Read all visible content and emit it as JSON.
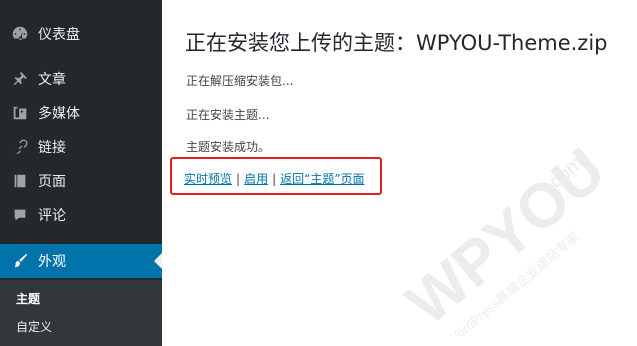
{
  "sidebar": {
    "items": [
      {
        "label": "仪表盘",
        "icon": "dashboard-icon"
      },
      {
        "label": "文章",
        "icon": "pushpin-icon"
      },
      {
        "label": "多媒体",
        "icon": "media-icon"
      },
      {
        "label": "链接",
        "icon": "link-icon"
      },
      {
        "label": "页面",
        "icon": "page-icon"
      },
      {
        "label": "评论",
        "icon": "comment-icon"
      },
      {
        "label": "外观",
        "icon": "paintbrush-icon",
        "active": true
      }
    ],
    "submenu": [
      {
        "label": "主题",
        "current": true
      },
      {
        "label": "自定义"
      }
    ]
  },
  "main": {
    "title": "正在安装您上传的主题：WPYOU-Theme.zip",
    "messages": [
      "正在解压缩安装包...",
      "正在安装主题...",
      "主题安装成功。"
    ],
    "links": {
      "preview": "实时预览",
      "activate": "启用",
      "back": "返回“主题”页面",
      "separator": "|"
    }
  },
  "watermark": {
    "brand": "WPYOU",
    "domain": ".com",
    "tagline": "WordPress高端企业建站专家"
  },
  "colors": {
    "sidebar_bg": "#23282d",
    "active_bg": "#0073aa",
    "link": "#0073aa",
    "highlight_border": "#e02020"
  }
}
